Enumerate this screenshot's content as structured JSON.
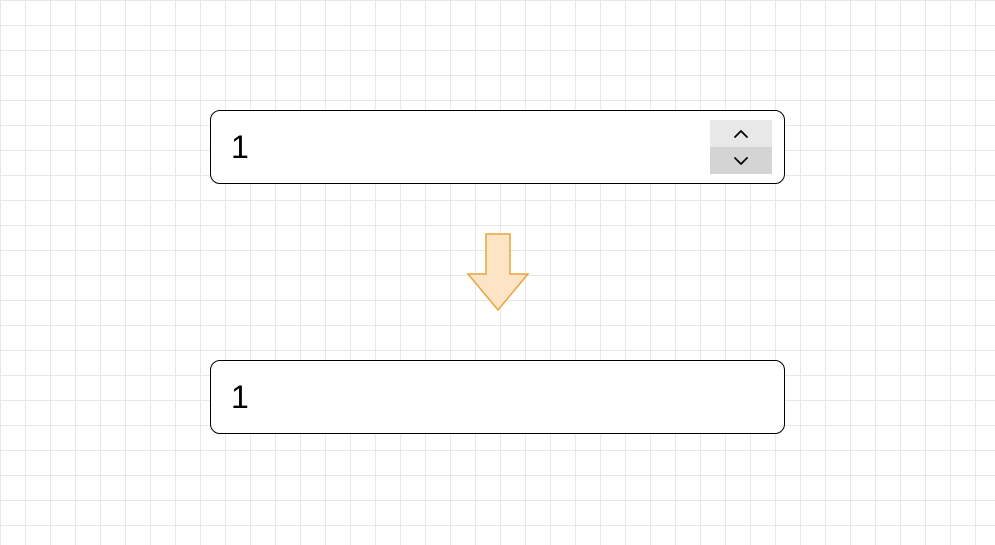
{
  "input_top": {
    "value": "1"
  },
  "input_bottom": {
    "value": "1"
  },
  "arrow": {
    "fill": "#fde4c4",
    "stroke": "#e8a33d"
  }
}
